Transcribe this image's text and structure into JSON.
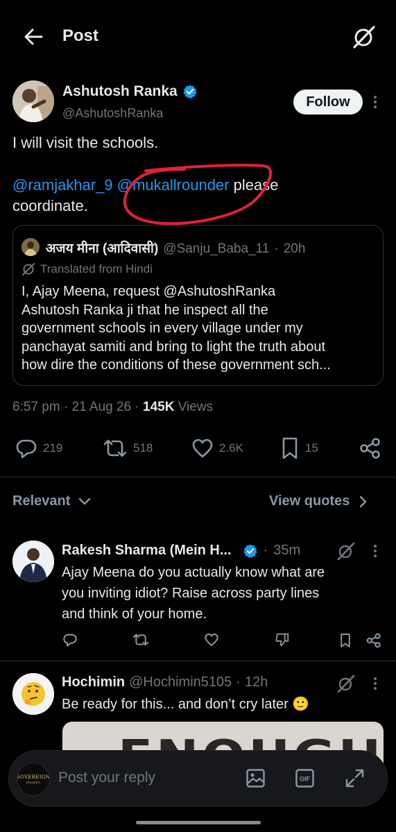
{
  "header": {
    "title": "Post",
    "back_icon": "back-arrow-icon",
    "grok_icon": "grok-icon"
  },
  "post": {
    "author_name": "Ashutosh Ranka",
    "verified": true,
    "author_handle": "@AshutoshRanka",
    "follow_label": "Follow",
    "text_line1": "I will visit the schools.",
    "mention1": "@ramjakhar_9",
    "mention2": "@mukallrounder",
    "text_after_mentions": " please",
    "text_line4": "coordinate.",
    "annotation_color": "#e0213a",
    "quote": {
      "author_name": "अजय मीना (आदिवासी)",
      "author_handle": "@Sanju_Baba_11",
      "separator": "·",
      "time": "20h",
      "translated_label": "Translated from Hindi",
      "lines": [
        "I, Ajay Meena, request @AshutoshRanka",
        "Ashutosh Ranka ji that he inspect all the",
        "government schools in every village under my",
        "panchayat samiti and bring to light the truth about",
        "how dire the conditions of these government sch..."
      ]
    },
    "timestamp": "6:57 pm · 21 Aug 26 · ",
    "views_count": "145K",
    "views_label": " Views",
    "stats": {
      "replies": "219",
      "reposts": "518",
      "likes": "2.6K",
      "bookmarks": "15"
    }
  },
  "sort": {
    "label": "Relevant",
    "view_quotes": "View quotes"
  },
  "replies": [
    {
      "name": "Rakesh Sharma (Mein H...",
      "verified": true,
      "separator": "·",
      "time": "35m",
      "lines": [
        "Ajay Meena do you actually know what are",
        "you inviting idiot? Raise across party lines",
        "and think of your home."
      ]
    },
    {
      "name": "Hochimin",
      "handle": "@Hochimin5105",
      "separator": "·",
      "time": "12h",
      "text": "Be ready for this... and don’t cry later 🙂",
      "media_text": "ENOUGH"
    }
  ],
  "composer": {
    "avatar_text_top": "SOVEREIGN",
    "avatar_text_bottom": "SHARES",
    "placeholder": "Post your reply"
  },
  "colors": {
    "background": "#000000",
    "text": "#e7e9ea",
    "muted": "#71767b",
    "accent": "#1d9bf0",
    "divider": "#2f3336"
  }
}
